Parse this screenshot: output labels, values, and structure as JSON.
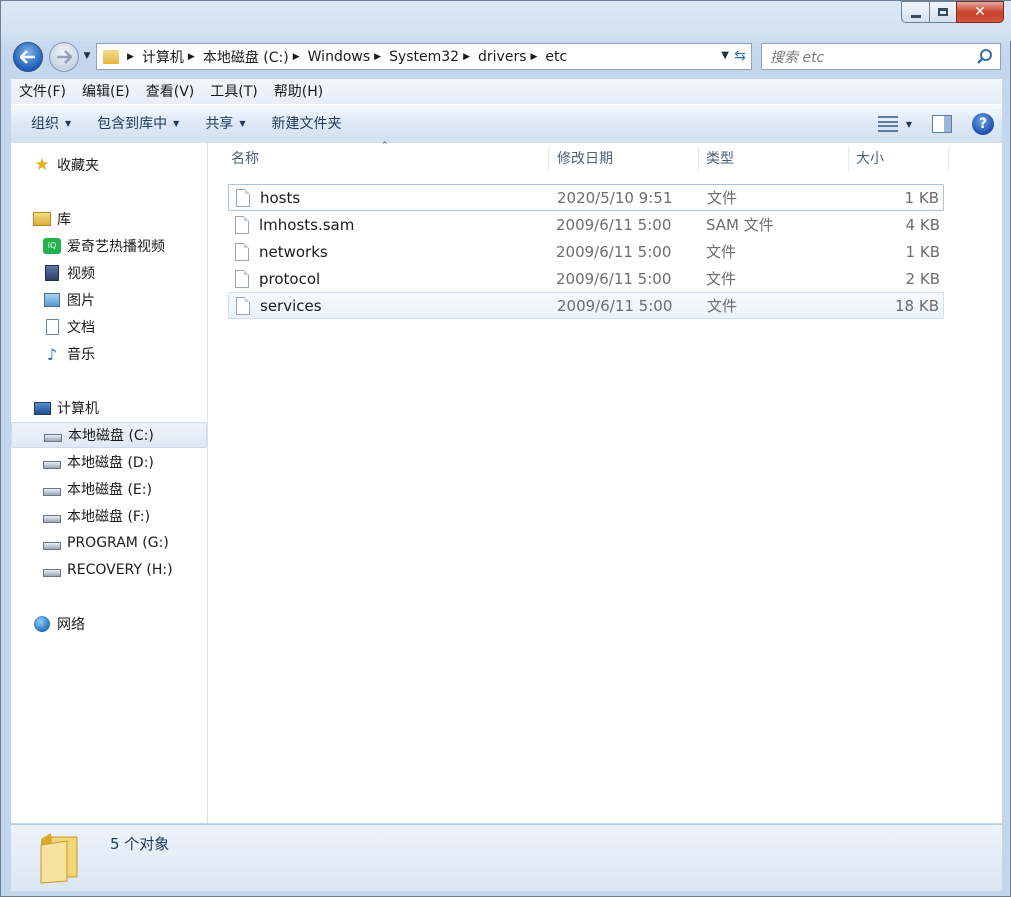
{
  "window": {
    "controls": [
      "minimize",
      "maximize",
      "close"
    ]
  },
  "address": {
    "crumbs": [
      "计算机",
      "本地磁盘 (C:)",
      "Windows",
      "System32",
      "drivers",
      "etc"
    ]
  },
  "search": {
    "placeholder": "搜索 etc"
  },
  "menu": [
    "文件(F)",
    "编辑(E)",
    "查看(V)",
    "工具(T)",
    "帮助(H)"
  ],
  "toolbar": {
    "organize": "组织",
    "include_library": "包含到库中",
    "share": "共享",
    "new_folder": "新建文件夹"
  },
  "nav": {
    "favorites": "收藏夹",
    "libraries": "库",
    "lib_items": [
      "爱奇艺热播视频",
      "视频",
      "图片",
      "文档",
      "音乐"
    ],
    "computer": "计算机",
    "drives": [
      "本地磁盘 (C:)",
      "本地磁盘 (D:)",
      "本地磁盘 (E:)",
      "本地磁盘 (F:)",
      "PROGRAM (G:)",
      "RECOVERY (H:)"
    ],
    "network": "网络"
  },
  "columns": {
    "name": "名称",
    "modified": "修改日期",
    "type": "类型",
    "size": "大小"
  },
  "files": [
    {
      "name": "hosts",
      "modified": "2020/5/10 9:51",
      "type": "文件",
      "size": "1 KB"
    },
    {
      "name": "lmhosts.sam",
      "modified": "2009/6/11 5:00",
      "type": "SAM 文件",
      "size": "4 KB"
    },
    {
      "name": "networks",
      "modified": "2009/6/11 5:00",
      "type": "文件",
      "size": "1 KB"
    },
    {
      "name": "protocol",
      "modified": "2009/6/11 5:00",
      "type": "文件",
      "size": "2 KB"
    },
    {
      "name": "services",
      "modified": "2009/6/11 5:00",
      "type": "文件",
      "size": "18 KB"
    }
  ],
  "status": {
    "count_text": "5 个对象"
  },
  "colors": {
    "accent": "#1e395b",
    "selection_border": "#a7c3e8",
    "close_red": "#c7432c"
  }
}
